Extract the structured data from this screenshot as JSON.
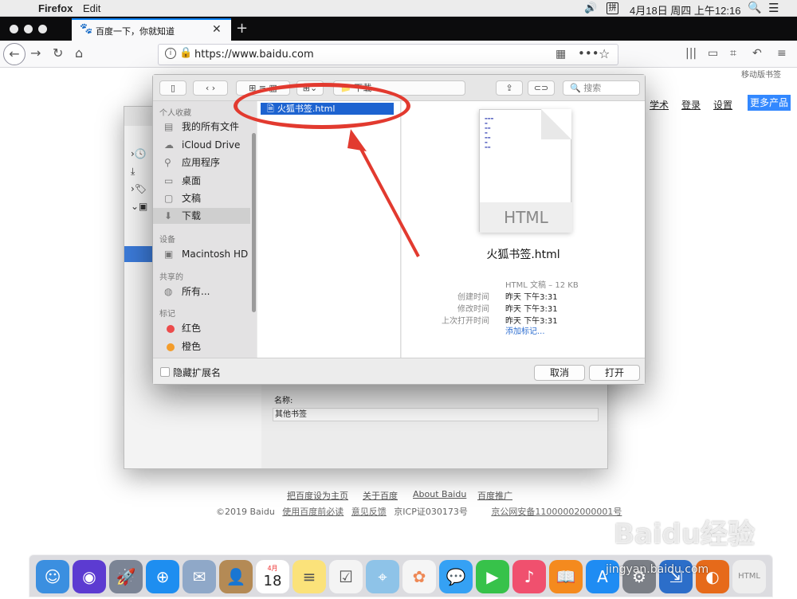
{
  "menubar": {
    "app": "Firefox",
    "edit": "Edit",
    "clock": "4月18日 周四 上午12:16",
    "ime": "拼"
  },
  "tab": {
    "title": "百度一下，你就知道"
  },
  "navbar": {
    "url": "https://www.baidu.com",
    "mobile_bookmarks": "移动版书签"
  },
  "baidu": {
    "top_links": [
      "学术",
      "登录",
      "设置"
    ],
    "more_products": "更多产品",
    "footer_links": [
      "把百度设为主页",
      "关于百度",
      "About Baidu",
      "百度推广"
    ],
    "footer_line": [
      "©2019 Baidu",
      "使用百度前必读",
      "意见反馈",
      "京ICP证030173号",
      "京公网安备11000002000001号"
    ]
  },
  "library": {
    "name_label": "名称:",
    "name_value": "其他书签"
  },
  "dialog": {
    "search_placeholder": "搜索",
    "location": "下载",
    "sidebar": {
      "favorites_header": "个人收藏",
      "favorites": [
        "我的所有文件",
        "iCloud Drive",
        "应用程序",
        "桌面",
        "文稿",
        "下载"
      ],
      "devices_header": "设备",
      "devices": [
        "Macintosh HD"
      ],
      "shared_header": "共享的",
      "shared": [
        "所有..."
      ],
      "tags_header": "标记",
      "tags": [
        {
          "label": "红色",
          "color": "#ec4b4b"
        },
        {
          "label": "橙色",
          "color": "#f39c2b"
        }
      ]
    },
    "selected_file": "火狐书签.html",
    "preview": {
      "badge": "HTML",
      "name": "火狐书签.html",
      "kind": "HTML 文稿 – 12 KB",
      "created_label": "创建时间",
      "created": "昨天 下午3:31",
      "modified_label": "修改时间",
      "modified": "昨天 下午3:31",
      "opened_label": "上次打开时间",
      "opened": "昨天 下午3:31",
      "add_tags": "添加标记..."
    },
    "hide_ext": "隐藏扩展名",
    "cancel": "取消",
    "open": "打开"
  },
  "dock": {
    "calendar_day": "18",
    "calendar_month": "4月"
  },
  "watermark": {
    "brand": "Baidu经验",
    "site": "jingyan.baidu.com"
  },
  "colors": {
    "accent": "#1d63d0",
    "annotation": "#e23a2f",
    "baidu_blue": "#3388ff"
  }
}
